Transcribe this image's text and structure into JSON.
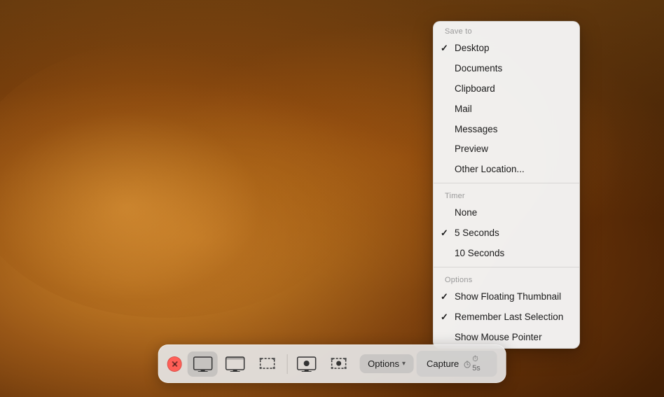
{
  "desktop": {
    "bg_description": "macOS Mojave desert wallpaper"
  },
  "dropdown": {
    "save_to_label": "Save to",
    "items_save": [
      {
        "label": "Desktop",
        "checked": true
      },
      {
        "label": "Documents",
        "checked": false
      },
      {
        "label": "Clipboard",
        "checked": false
      },
      {
        "label": "Mail",
        "checked": false
      },
      {
        "label": "Messages",
        "checked": false
      },
      {
        "label": "Preview",
        "checked": false
      },
      {
        "label": "Other Location...",
        "checked": false
      }
    ],
    "timer_label": "Timer",
    "items_timer": [
      {
        "label": "None",
        "checked": false
      },
      {
        "label": "5 Seconds",
        "checked": true
      },
      {
        "label": "10 Seconds",
        "checked": false
      }
    ],
    "options_label": "Options",
    "items_options": [
      {
        "label": "Show Floating Thumbnail",
        "checked": true
      },
      {
        "label": "Remember Last Selection",
        "checked": true
      },
      {
        "label": "Show Mouse Pointer",
        "checked": false
      }
    ]
  },
  "toolbar": {
    "close_label": "×",
    "options_label": "Options",
    "chevron": "▾",
    "capture_label": "Capture",
    "capture_timer": "⏱ 5s",
    "buttons": [
      {
        "name": "capture-entire-screen",
        "tooltip": "Capture Entire Screen"
      },
      {
        "name": "capture-window",
        "tooltip": "Capture Selected Window"
      },
      {
        "name": "capture-selection",
        "tooltip": "Capture Selected Portion"
      },
      {
        "name": "record-screen",
        "tooltip": "Record Entire Screen"
      },
      {
        "name": "record-selection",
        "tooltip": "Record Selected Portion"
      }
    ]
  }
}
